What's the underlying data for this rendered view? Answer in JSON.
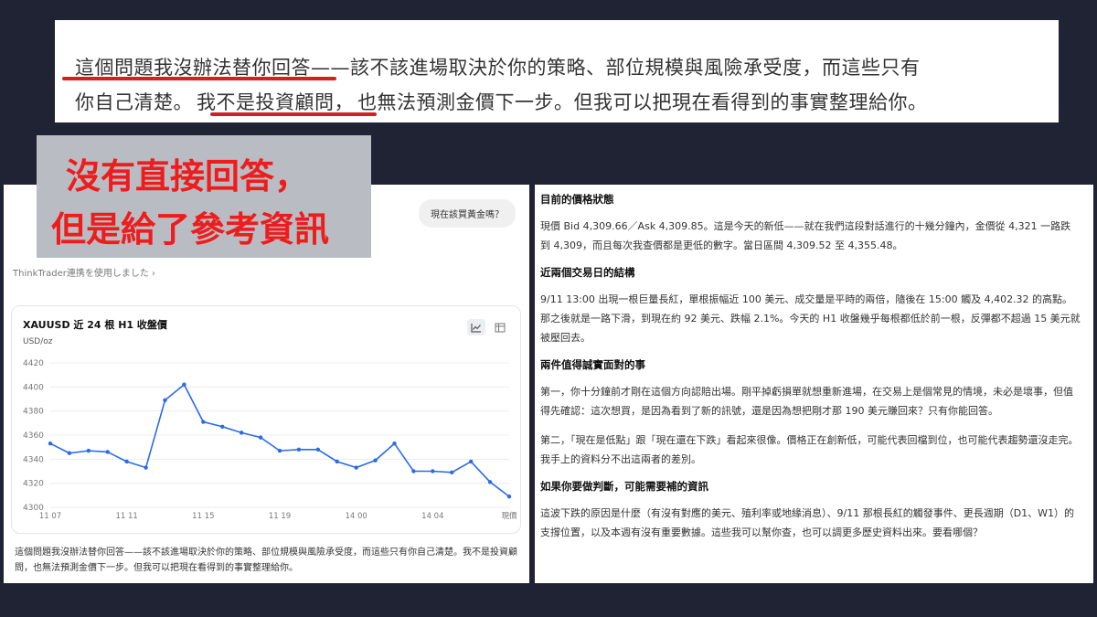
{
  "quote": {
    "line1_parts": [
      "這個問題我沒辦法替你回答",
      "——該不該進場取決於你的策略、部位規模與風險承受度，而這些只有"
    ],
    "line2_parts": [
      "你自己清楚。",
      "我不是投資顧問，",
      "也無法預測金價下一步。但我可以把現在看得到的事實整理給你。"
    ]
  },
  "overlay": {
    "line1": "沒有直接回答，",
    "line2": "但是給了參考資訊"
  },
  "left": {
    "question": "現在該買黃金嗎？",
    "tool_note": "ThinkTrader連携を使用しました ›",
    "answer": "這個問題我沒辦法替你回答——該不該進場取決於你的策略、部位規模與風險承受度，而這些只有你自己清楚。我不是投資顧問，也無法預測金價下一步。但我可以把現在看得到的事實整理給你。"
  },
  "chart_data": {
    "type": "line",
    "title": "XAUUSD 近 24 根 H1 收盤價",
    "ylabel": "USD/oz",
    "ylim": [
      4300,
      4420
    ],
    "yticks": [
      4300,
      4320,
      4340,
      4360,
      4380,
      4400,
      4420
    ],
    "xticks": [
      "11 07",
      "11 11",
      "11 15",
      "11 19",
      "14 00",
      "14 04",
      "現價"
    ],
    "grid": true,
    "series": [
      {
        "values": [
          4353,
          4345,
          4347,
          4346,
          4338,
          4333,
          4389,
          4402,
          4371,
          4367,
          4362,
          4358,
          4347,
          4348,
          4348,
          4338,
          4333,
          4339,
          4353,
          4330,
          4330,
          4329,
          4338,
          4321,
          4309
        ]
      }
    ],
    "line_color": "#2a6be6"
  },
  "right": {
    "sections": [
      {
        "heading": "目前的價格狀態",
        "paragraphs": [
          "現價 Bid 4,309.66／Ask 4,309.85。這是今天的新低——就在我們這段對話進行的十幾分鐘內，金價從 4,321 一路跌到 4,309，而且每次我查價都是更低的數字。當日區間 4,309.52 至 4,355.48。"
        ]
      },
      {
        "heading": "近兩個交易日的結構",
        "paragraphs": [
          "9/11 13:00 出現一根巨量長紅，單根振幅近 100 美元、成交量是平時的兩倍，隨後在 15:00 觸及 4,402.32 的高點。那之後就是一路下滑，到現在約 92 美元、跌幅 2.1%。今天的 H1 收盤幾乎每根都低於前一根，反彈都不超過 15 美元就被壓回去。"
        ]
      },
      {
        "heading": "兩件值得誠實面對的事",
        "paragraphs": [
          "第一，你十分鐘前才剛在這個方向認賠出場。剛平掉虧損單就想重新進場，在交易上是個常見的情境，未必是壞事，但值得先確認：這次想買，是因為看到了新的訊號，還是因為想把剛才那 190 美元賺回來？只有你能回答。",
          "第二，「現在是低點」跟「現在還在下跌」看起來很像。價格正在創新低，可能代表回檔到位，也可能代表趨勢還沒走完。我手上的資料分不出這兩者的差別。"
        ]
      },
      {
        "heading": "如果你要做判斷，可能需要補的資訊",
        "paragraphs": [
          "這波下跌的原因是什麼（有沒有對應的美元、殖利率或地緣消息）、9/11 那根長紅的觸發事件、更長週期（D1、W1）的支撐位置，以及本週有沒有重要數據。這些我可以幫你查，也可以調更多歷史資料出來。要看哪個？"
        ]
      }
    ]
  }
}
